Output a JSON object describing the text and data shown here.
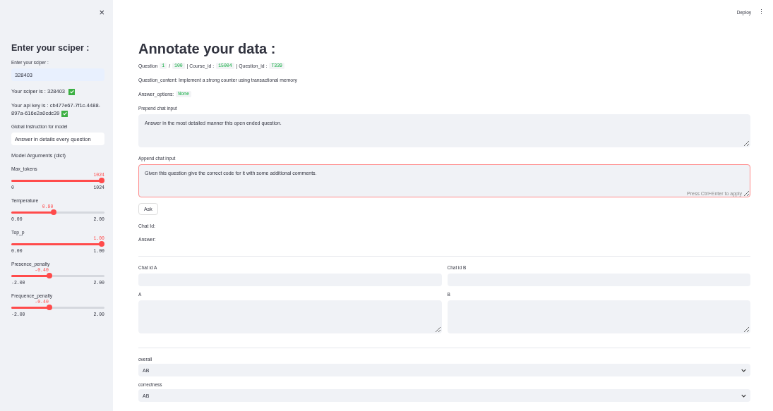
{
  "toolbar": {
    "close": "×",
    "deploy": "Deploy",
    "menu": "⋮"
  },
  "sidebar": {
    "title": "Enter your sciper :",
    "sciper_field": {
      "label": "Enter your sciper :",
      "value": "328403"
    },
    "sciper_status": "Your sciper is : 328403",
    "sciper_ok": true,
    "api_status": "Your api key is : cb477e67-7f1c-4488-897a-616e2a0cdc39",
    "api_ok": true,
    "instruction_field": {
      "label": "Global Instruction for model",
      "value": "Answer in details every question"
    },
    "args_label": "Model Arguments (dict)",
    "sliders": [
      {
        "label": "Max_tokens",
        "reading": "1024",
        "min": "0",
        "max": "1024",
        "level": 1
      },
      {
        "label": "Temperature",
        "reading": "0.90",
        "min": "0.00",
        "max": "2.00",
        "level": 0.45
      },
      {
        "label": "Top_p",
        "reading": "1.00",
        "min": "0.00",
        "max": "1.00",
        "level": 1
      },
      {
        "label": "Presence_penalty",
        "reading": "-0.40",
        "min": "-2.00",
        "max": "2.00",
        "level": 0.4
      },
      {
        "label": "Frequence_penalty",
        "reading": "-0.40",
        "min": "-2.00",
        "max": "2.00",
        "level": 0.4
      }
    ]
  },
  "main": {
    "title": "Annotate your data :",
    "question_line": [
      {
        "kind": "text",
        "text": "Question"
      },
      {
        "kind": "code",
        "text": "1"
      },
      {
        "kind": "text",
        "text": "/"
      },
      {
        "kind": "code",
        "text": "100"
      },
      {
        "kind": "text",
        "text": "| Course_id :"
      },
      {
        "kind": "code",
        "text": "15004"
      },
      {
        "kind": "text",
        "text": "| Question_id :"
      },
      {
        "kind": "code",
        "text": "T339"
      }
    ],
    "question_content": "Question_content: Implement a strong counter using transactional memory",
    "answer_options": {
      "label": "Answer_options:",
      "value": "None"
    },
    "prepend": {
      "label": "Prepend chat input",
      "value": "Answer in the most detailed manner this open ended question.",
      "focused": false
    },
    "append": {
      "label": "Append chat input",
      "value": "Given this question give the correct code for it with some additional comments.",
      "focused": true,
      "hint": "Press Ctrl+Enter to apply"
    },
    "ask_button": "Ask",
    "chat_id": "Chat Id:",
    "answer": "Answer:",
    "compare": [
      {
        "label": "Chat id A",
        "answer_label": "A"
      },
      {
        "label": "Chat id B",
        "answer_label": "B"
      }
    ],
    "selects": [
      {
        "label": "overall",
        "value": "AB"
      },
      {
        "label": "correctness",
        "value": "AB"
      }
    ]
  }
}
